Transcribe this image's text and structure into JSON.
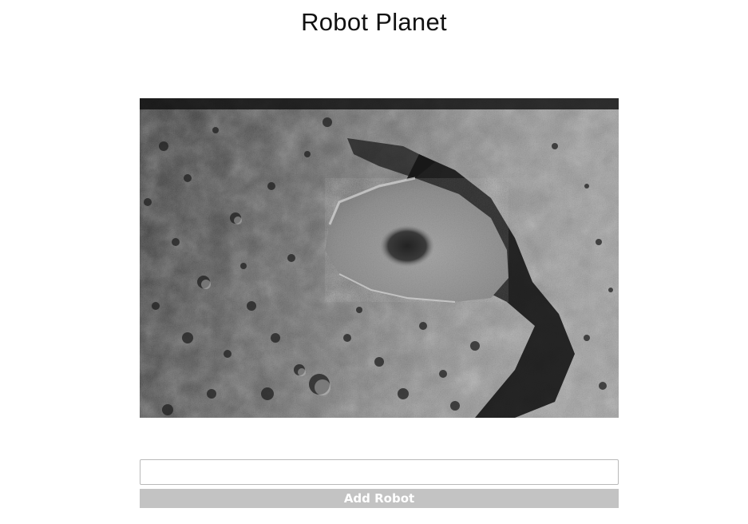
{
  "page": {
    "title": "Robot Planet"
  },
  "form": {
    "input_value": "",
    "input_placeholder": "",
    "add_button_label": "Add Robot"
  },
  "image": {
    "subject": "cratered-planet-surface",
    "palette": "grayscale"
  }
}
